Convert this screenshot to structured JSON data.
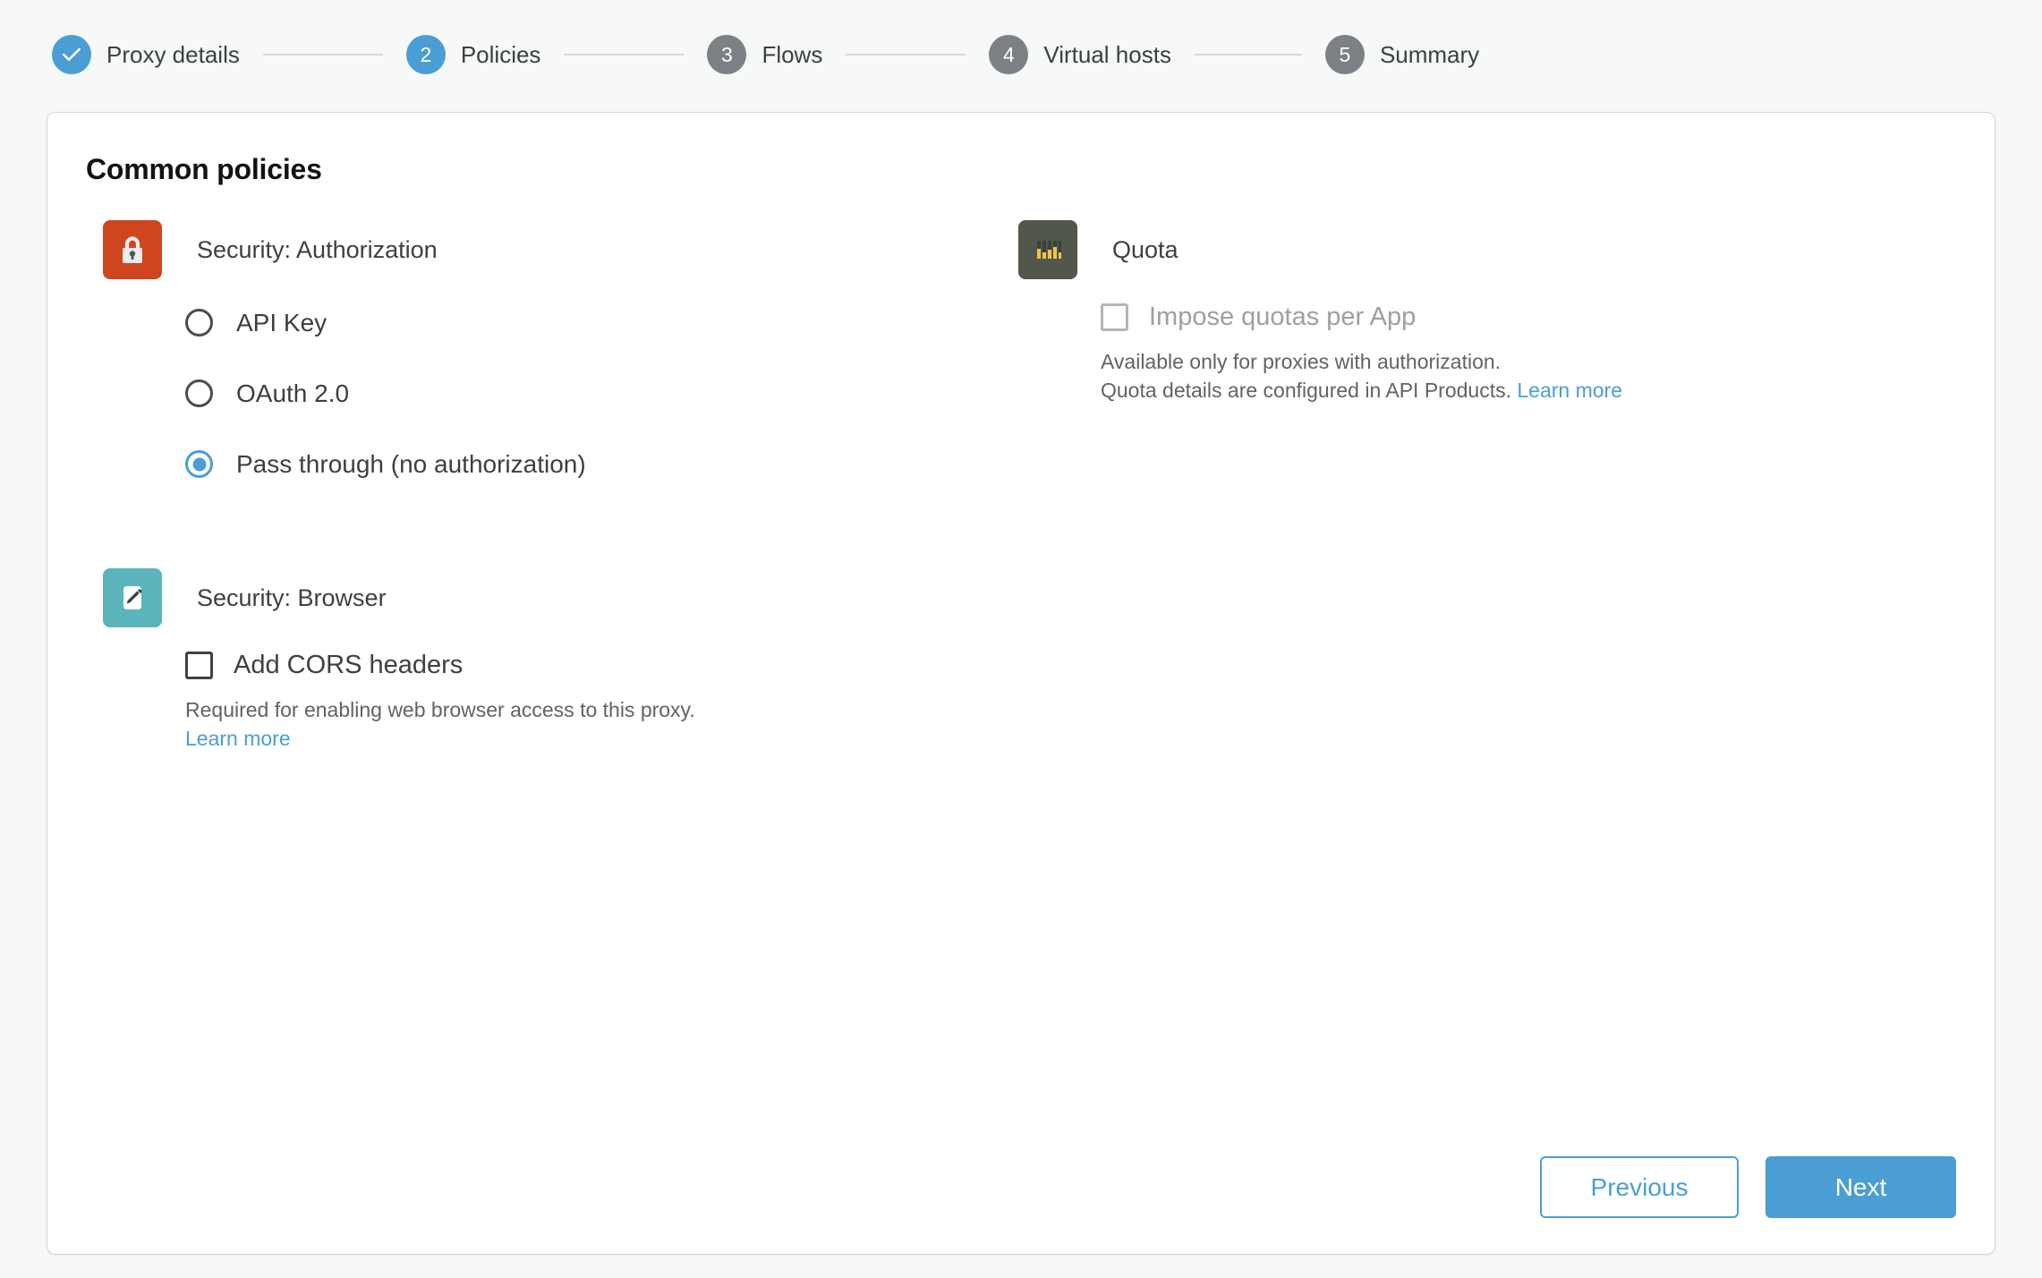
{
  "stepper": {
    "steps": [
      {
        "badge": "check-icon",
        "label": "Proxy details",
        "state": "done"
      },
      {
        "badge": "2",
        "label": "Policies",
        "state": "current"
      },
      {
        "badge": "3",
        "label": "Flows",
        "state": "todo"
      },
      {
        "badge": "4",
        "label": "Virtual hosts",
        "state": "todo"
      },
      {
        "badge": "5",
        "label": "Summary",
        "state": "todo"
      }
    ]
  },
  "card": {
    "title": "Common policies",
    "groups": {
      "authorization": {
        "icon": "lock-icon",
        "name": "Security: Authorization",
        "options": [
          {
            "label": "API Key",
            "checked": false
          },
          {
            "label": "OAuth 2.0",
            "checked": false
          },
          {
            "label": "Pass through (no authorization)",
            "checked": true
          }
        ]
      },
      "browser": {
        "icon": "pencil-icon",
        "name": "Security: Browser",
        "checkbox_label": "Add CORS headers",
        "checked": false,
        "help_line1": "Required for enabling web browser access to this proxy.",
        "learn_more": "Learn more"
      },
      "quota": {
        "icon": "quota-bars-icon",
        "name": "Quota",
        "checkbox_label": "Impose quotas per App",
        "checked": false,
        "disabled": true,
        "help_line1": "Available only for proxies with authorization.",
        "help_line2": "Quota details are configured in API Products.",
        "learn_more": "Learn more"
      }
    },
    "footer": {
      "previous_label": "Previous",
      "next_label": "Next"
    }
  },
  "colors": {
    "accent": "#4a9ed4",
    "step_inactive": "#7d8185",
    "lock_bg": "#cf4520",
    "pencil_bg": "#5bb4bb",
    "quota_bg": "#51574d",
    "quota_bars": "#f3c344",
    "page_bg": "#f7f8f8",
    "card_bg": "#ffffff",
    "link": "#4a9ed4"
  }
}
